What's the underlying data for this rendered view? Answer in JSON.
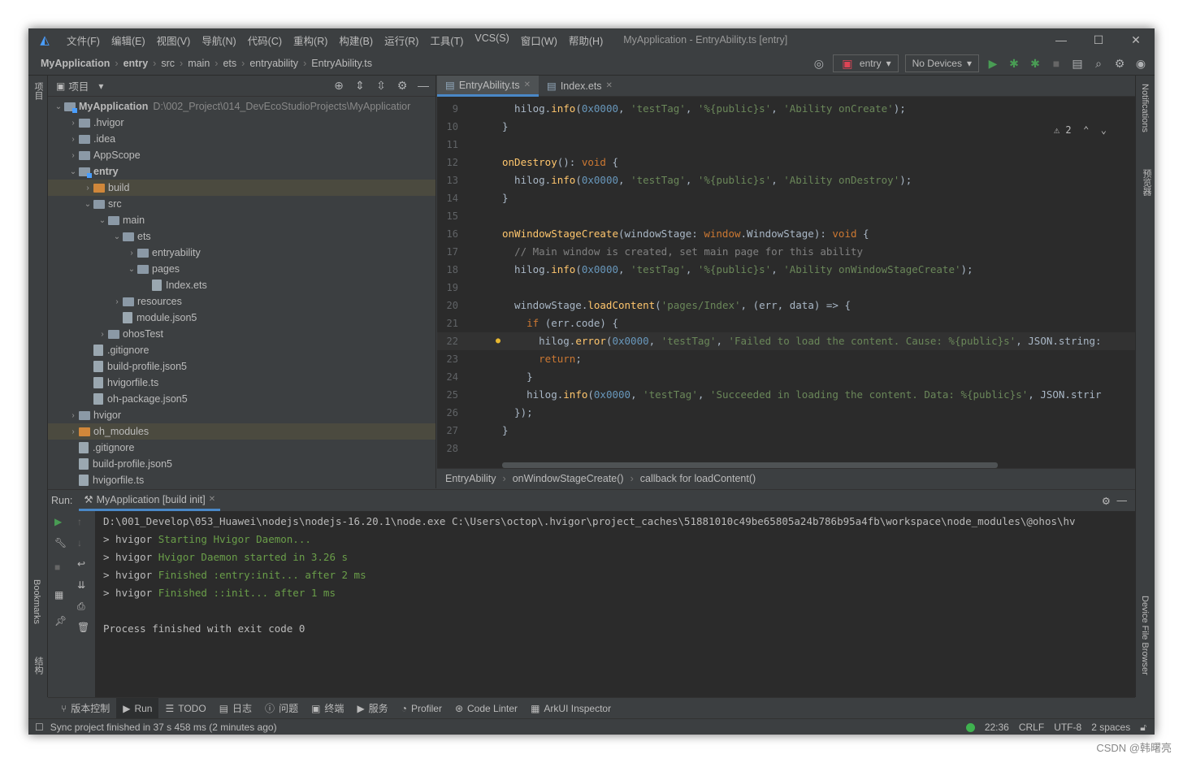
{
  "window": {
    "menu": [
      "文件(F)",
      "编辑(E)",
      "视图(V)",
      "导航(N)",
      "代码(C)",
      "重构(R)",
      "构建(B)",
      "运行(R)",
      "工具(T)",
      "VCS(S)",
      "窗口(W)",
      "帮助(H)"
    ],
    "title": "MyApplication - EntryAbility.ts [entry]"
  },
  "breadcrumb": [
    "MyApplication",
    "entry",
    "src",
    "main",
    "ets",
    "entryability",
    "EntryAbility.ts"
  ],
  "toolbar": {
    "config": "entry",
    "devices": "No Devices"
  },
  "left_strip": {
    "project": "项目",
    "bookmarks": "Bookmarks",
    "structure": "结构"
  },
  "right_strip": {
    "notifications": "Notifications",
    "preview": "预览器",
    "device_file_browser": "Device File Browser"
  },
  "project_panel": {
    "title": "项目"
  },
  "tree": [
    {
      "label": "MyApplication",
      "path": "D:\\002_Project\\014_DevEcoStudioProjects\\MyApplicatior",
      "indent": 0,
      "arrow": "v",
      "type": "module",
      "bold": true
    },
    {
      "label": ".hvigor",
      "indent": 1,
      "arrow": ">",
      "type": "folder"
    },
    {
      "label": ".idea",
      "indent": 1,
      "arrow": ">",
      "type": "folder"
    },
    {
      "label": "AppScope",
      "indent": 1,
      "arrow": ">",
      "type": "folder"
    },
    {
      "label": "entry",
      "indent": 1,
      "arrow": "v",
      "type": "module",
      "bold": true
    },
    {
      "label": "build",
      "indent": 2,
      "arrow": ">",
      "type": "orange",
      "selected": true
    },
    {
      "label": "src",
      "indent": 2,
      "arrow": "v",
      "type": "folder"
    },
    {
      "label": "main",
      "indent": 3,
      "arrow": "v",
      "type": "folder"
    },
    {
      "label": "ets",
      "indent": 4,
      "arrow": "v",
      "type": "folder"
    },
    {
      "label": "entryability",
      "indent": 5,
      "arrow": ">",
      "type": "folder"
    },
    {
      "label": "pages",
      "indent": 5,
      "arrow": "v",
      "type": "folder"
    },
    {
      "label": "Index.ets",
      "indent": 6,
      "arrow": "",
      "type": "file"
    },
    {
      "label": "resources",
      "indent": 4,
      "arrow": ">",
      "type": "folder"
    },
    {
      "label": "module.json5",
      "indent": 4,
      "arrow": "",
      "type": "file"
    },
    {
      "label": "ohosTest",
      "indent": 3,
      "arrow": ">",
      "type": "folder"
    },
    {
      "label": ".gitignore",
      "indent": 2,
      "arrow": "",
      "type": "file"
    },
    {
      "label": "build-profile.json5",
      "indent": 2,
      "arrow": "",
      "type": "file"
    },
    {
      "label": "hvigorfile.ts",
      "indent": 2,
      "arrow": "",
      "type": "file"
    },
    {
      "label": "oh-package.json5",
      "indent": 2,
      "arrow": "",
      "type": "file"
    },
    {
      "label": "hvigor",
      "indent": 1,
      "arrow": ">",
      "type": "folder"
    },
    {
      "label": "oh_modules",
      "indent": 1,
      "arrow": ">",
      "type": "orange",
      "selected": true
    },
    {
      "label": ".gitignore",
      "indent": 1,
      "arrow": "",
      "type": "file"
    },
    {
      "label": "build-profile.json5",
      "indent": 1,
      "arrow": "",
      "type": "file"
    },
    {
      "label": "hvigorfile.ts",
      "indent": 1,
      "arrow": "",
      "type": "file"
    }
  ],
  "editor": {
    "tabs": [
      "EntryAbility.ts",
      "Index.ets"
    ],
    "warnings": "2",
    "lines": [
      {
        "n": "9",
        "html": "  hilog.<span class=\"fn\">info</span>(<span class=\"nm\">0x0000</span>, <span class=\"st\">'testTag'</span>, <span class=\"st\">'%{public}s'</span>, <span class=\"st\">'Ability onCreate'</span>);"
      },
      {
        "n": "10",
        "html": "}"
      },
      {
        "n": "11",
        "html": ""
      },
      {
        "n": "12",
        "html": "<span class=\"fn\">onDestroy</span>(): <span class=\"kw\">void</span> {"
      },
      {
        "n": "13",
        "html": "  hilog.<span class=\"fn\">info</span>(<span class=\"nm\">0x0000</span>, <span class=\"st\">'testTag'</span>, <span class=\"st\">'%{public}s'</span>, <span class=\"st\">'Ability onDestroy'</span>);"
      },
      {
        "n": "14",
        "html": "}"
      },
      {
        "n": "15",
        "html": ""
      },
      {
        "n": "16",
        "html": "<span class=\"fn\">onWindowStageCreate</span>(windowStage: <span class=\"kw\">window</span>.WindowStage): <span class=\"kw\">void</span> {"
      },
      {
        "n": "17",
        "html": "  <span class=\"cm\">// Main window is created, set main page for this ability</span>"
      },
      {
        "n": "18",
        "html": "  hilog.<span class=\"fn\">info</span>(<span class=\"nm\">0x0000</span>, <span class=\"st\">'testTag'</span>, <span class=\"st\">'%{public}s'</span>, <span class=\"st\">'Ability onWindowStageCreate'</span>);"
      },
      {
        "n": "19",
        "html": ""
      },
      {
        "n": "20",
        "html": "  windowStage.<span class=\"fn\">loadContent</span>(<span class=\"st\">'pages/Index'</span>, (err, data) => {"
      },
      {
        "n": "21",
        "html": "    <span class=\"kw\">if</span> (err.code) {"
      },
      {
        "n": "22",
        "html": "      hilog.<span class=\"fn\">error</span>(<span class=\"nm\">0x0000</span>, <span class=\"st\">'testTag'</span>, <span class=\"st\">'Failed to load the content. Cause: %{public}s'</span>, JSON.string:"
      },
      {
        "n": "23",
        "html": "      <span class=\"kw\">return</span>;"
      },
      {
        "n": "24",
        "html": "    }"
      },
      {
        "n": "25",
        "html": "    hilog.<span class=\"fn\">info</span>(<span class=\"nm\">0x0000</span>, <span class=\"st\">'testTag'</span>, <span class=\"st\">'Succeeded in loading the content. Data: %{public}s'</span>, JSON.strir"
      },
      {
        "n": "26",
        "html": "  });"
      },
      {
        "n": "27",
        "html": "}"
      },
      {
        "n": "28",
        "html": ""
      }
    ],
    "current_line": "22",
    "crumbs": [
      "EntryAbility",
      "onWindowStageCreate()",
      "callback for loadContent()"
    ]
  },
  "run": {
    "label": "Run:",
    "tab": "MyApplication [build init]",
    "console": [
      {
        "prefix": "",
        "text": "D:\\001_Develop\\053_Huawei\\nodejs\\nodejs-16.20.1\\node.exe C:\\Users\\octop\\.hvigor\\project_caches\\51881010c49be65805a24b786b95a4fb\\workspace\\node_modules\\@ohos\\hv",
        "green": ""
      },
      {
        "prefix": "> hvigor ",
        "green": "Starting Hvigor Daemon...",
        "text": ""
      },
      {
        "prefix": "> hvigor ",
        "green": "Hvigor Daemon started in 3.26 s",
        "text": ""
      },
      {
        "prefix": "> hvigor ",
        "green": "Finished :entry:init... after 2 ms",
        "text": ""
      },
      {
        "prefix": "> hvigor ",
        "green": "Finished ::init... after 1 ms",
        "text": ""
      },
      {
        "prefix": "",
        "green": "",
        "text": ""
      },
      {
        "prefix": "",
        "green": "",
        "text": "Process finished with exit code 0"
      }
    ]
  },
  "bottom_tools": [
    "版本控制",
    "Run",
    "TODO",
    "日志",
    "问题",
    "终端",
    "服务",
    "Profiler",
    "Code Linter",
    "ArkUI Inspector"
  ],
  "status": {
    "message": "Sync project finished in 37 s 458 ms (2 minutes ago)",
    "pos": "22:36",
    "eol": "CRLF",
    "enc": "UTF-8",
    "indent": "2 spaces"
  },
  "watermark": "CSDN @韩曙亮"
}
